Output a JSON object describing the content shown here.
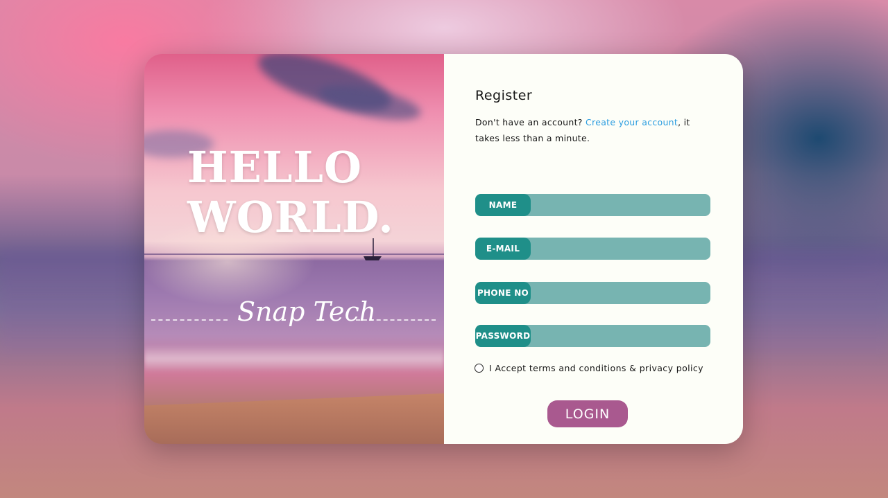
{
  "hero": {
    "headline_line1": "HELLO",
    "headline_line2": "WORLD.",
    "brand": "Snap Tech"
  },
  "form": {
    "title": "Register",
    "subtitle_prefix": "Don't have an account? ",
    "subtitle_link": "Create your account",
    "subtitle_suffix": ", it takes less than a minute.",
    "fields": [
      {
        "label": "NAME",
        "value": ""
      },
      {
        "label": "E-MAIL",
        "value": ""
      },
      {
        "label": "PHONE NO",
        "value": ""
      },
      {
        "label": "PASSWORD",
        "value": ""
      }
    ],
    "terms_label": "I Accept terms and conditions & privacy policy",
    "login_label": "LOGIN"
  },
  "colors": {
    "field_tag": "#1f8f89",
    "field_body": "#77b4b1",
    "link": "#2b9de0",
    "login_button": "#a9598f",
    "panel_bg": "#fdfef8"
  }
}
